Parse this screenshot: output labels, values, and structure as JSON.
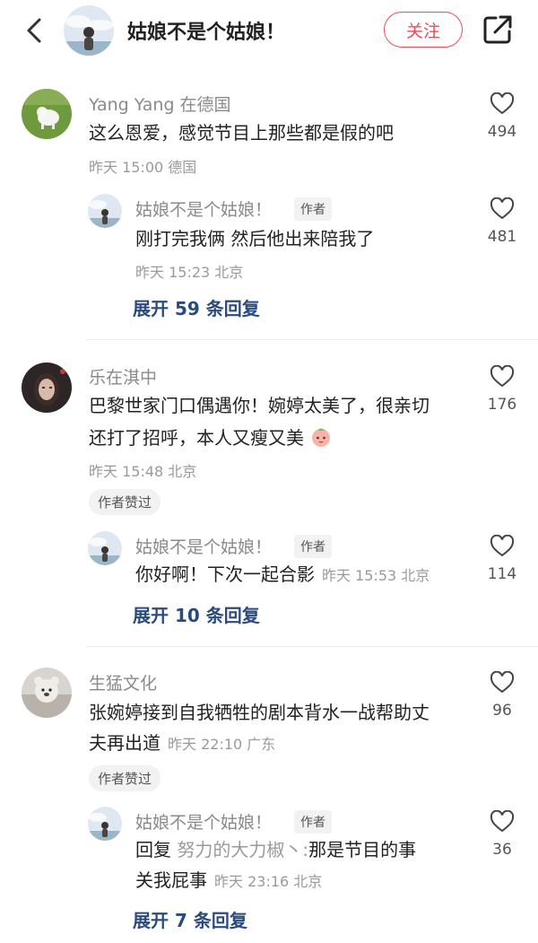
{
  "header": {
    "title": "姑娘不是个姑娘！",
    "follow_label": "关注"
  },
  "comments": [
    {
      "name": "Yang Yang 在德国",
      "text": "这么恩爱，感觉节目上那些都是假的吧",
      "meta": "昨天 15:00 德国",
      "likes": "494",
      "reply": {
        "name": "姑娘不是个姑娘！",
        "tag": "作者",
        "text": "刚打完我俩 然后他出来陪我了",
        "meta": "昨天 15:23 北京",
        "likes": "481"
      },
      "expand": "展开 59 条回复"
    },
    {
      "name": "乐在淇中",
      "text_line1": "巴黎世家门口偶遇你！婉婷太美了，很亲切",
      "text_line2": "还打了招呼，本人又瘦又美",
      "meta": "昨天 15:48 北京",
      "liked_tag": "作者赞过",
      "likes": "176",
      "reply": {
        "name": "姑娘不是个姑娘！",
        "tag": "作者",
        "text": "你好啊！下次一起合影",
        "meta": "昨天 15:53 北京",
        "likes": "114"
      },
      "expand": "展开 10 条回复"
    },
    {
      "name": "生猛文化",
      "text_line1": "张婉婷接到自我牺牲的剧本背水一战帮助丈",
      "text_line2": "夫再出道",
      "meta": "昨天 22:10 广东",
      "liked_tag": "作者赞过",
      "likes": "96",
      "reply": {
        "name": "姑娘不是个姑娘！",
        "tag": "作者",
        "reply_prefix": "回复",
        "reply_target": "努力的大力椒丶:",
        "text_line1_rest": "那是节目的事",
        "text_line2": "关我屁事",
        "meta": "昨天 23:16 北京",
        "likes": "36"
      },
      "expand": "展开 7 条回复"
    }
  ]
}
